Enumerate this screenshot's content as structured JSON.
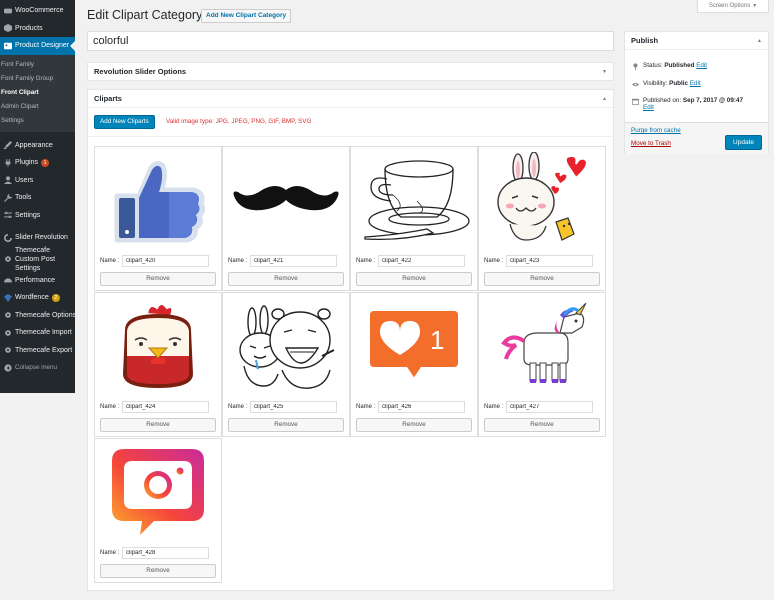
{
  "sidebar": {
    "items": [
      {
        "label": "WooCommerce",
        "icon": "woocommerce-icon"
      },
      {
        "label": "Products",
        "icon": "products-icon"
      },
      {
        "label": "Product Designer",
        "icon": "product-designer-icon"
      }
    ],
    "submenu": [
      "Font Family",
      "Font Family Group",
      "Front Clipart",
      "Admin Clipart",
      "Settings"
    ],
    "items2": [
      {
        "label": "Appearance",
        "icon": "appearance-icon"
      },
      {
        "label": "Plugins",
        "icon": "plugins-icon",
        "badge": "1"
      },
      {
        "label": "Users",
        "icon": "users-icon"
      },
      {
        "label": "Tools",
        "icon": "tools-icon"
      },
      {
        "label": "Settings",
        "icon": "settings-icon"
      }
    ],
    "items3": [
      {
        "label": "Slider Revolution",
        "icon": "slider-revolution-icon"
      },
      {
        "label": "Themecafe Custom Post Settings",
        "icon": "gear-icon"
      },
      {
        "label": "Performance",
        "icon": "performance-icon"
      },
      {
        "label": "Wordfence",
        "icon": "wordfence-icon",
        "badge": "2"
      },
      {
        "label": "Themecafe Options",
        "icon": "gear-icon"
      },
      {
        "label": "Themecafe Import",
        "icon": "gear-icon"
      },
      {
        "label": "Themecafe Export",
        "icon": "gear-icon"
      }
    ],
    "collapse_label": "Collapse menu"
  },
  "header": {
    "title": "Edit Clipart Category",
    "add_new_label": "Add New Clipart Category",
    "screen_options": "Screen Options"
  },
  "post_title": "colorful",
  "revolution_box": {
    "title": "Revolution Slider Options"
  },
  "cliparts_box": {
    "title": "Cliparts",
    "add_button": "Add New Cliparts",
    "valid_types": "Valid image type: JPG, JPEG, PNG, GIF, BMP, SVG",
    "name_label": "Name :",
    "remove_label": "Remove",
    "items": [
      {
        "name": "clipart_420",
        "image": "thumbs-up-image"
      },
      {
        "name": "clipart_421",
        "image": "mustache-image"
      },
      {
        "name": "clipart_422",
        "image": "teacup-image"
      },
      {
        "name": "clipart_423",
        "image": "bunny-hearts-image"
      },
      {
        "name": "clipart_424",
        "image": "chicken-image"
      },
      {
        "name": "clipart_425",
        "image": "bunny-bear-image"
      },
      {
        "name": "clipart_426",
        "image": "heart-notification-image"
      },
      {
        "name": "clipart_427",
        "image": "unicorn-image"
      },
      {
        "name": "clipart_428",
        "image": "instagram-logo-image"
      }
    ],
    "notification_count": "1"
  },
  "publish": {
    "title": "Publish",
    "status_label": "Status:",
    "status_value": "Published",
    "visibility_label": "Visibility:",
    "visibility_value": "Public",
    "published_label": "Published on:",
    "published_value": "Sep 7, 2017 @ 09:47",
    "edit_label": "Edit",
    "purge_label": "Purge from cache",
    "trash_label": "Move to Trash",
    "update_label": "Update"
  },
  "colors": {
    "accent": "#0073aa",
    "sidebar": "#23282d",
    "button_primary": "#0085ba",
    "danger": "#dc3232"
  }
}
